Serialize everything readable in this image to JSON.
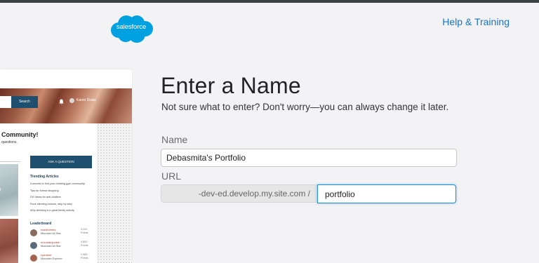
{
  "header": {
    "brand_text": "salesforce",
    "brand_color": "#00A1E0",
    "help_link": "Help & Training"
  },
  "preview": {
    "search_button": "Search",
    "user_name": "Karen Drake",
    "community_title": "Community!",
    "community_subtitle": "questions.",
    "image_caption": "t",
    "ask_button": "ASK A QUESTION",
    "trending_title": "Trending Articles",
    "articles": [
      "4 secrets to find your climbing gym community",
      "Tips for formal shopping",
      "DIY ideas for anti-chatters",
      "Rock climbing indoors, step by step",
      "Why climbing is a great family activity"
    ],
    "leaderboard_title": "Leaderboard",
    "leaders": [
      {
        "name": "madeclimbs",
        "badge": "Mountain All Star",
        "points": "3,200",
        "unit": "Points"
      },
      {
        "name": "mountainjunkie",
        "badge": "Mountain All Star",
        "points": "4,800",
        "unit": "Points"
      },
      {
        "name": "ryanasel",
        "badge": "Mountain Explorer",
        "points": "2,980",
        "unit": "Points"
      }
    ]
  },
  "form": {
    "heading": "Enter a Name",
    "subheading": "Not sure what to enter? Don't worry—you can always change it later.",
    "name_label": "Name",
    "name_value": "Debasmita's Portfolio",
    "url_label": "URL",
    "url_prefix": "-dev-ed.develop.my.site.com /",
    "url_value": "portfolio",
    "accent_color": "#1B8FD8"
  }
}
